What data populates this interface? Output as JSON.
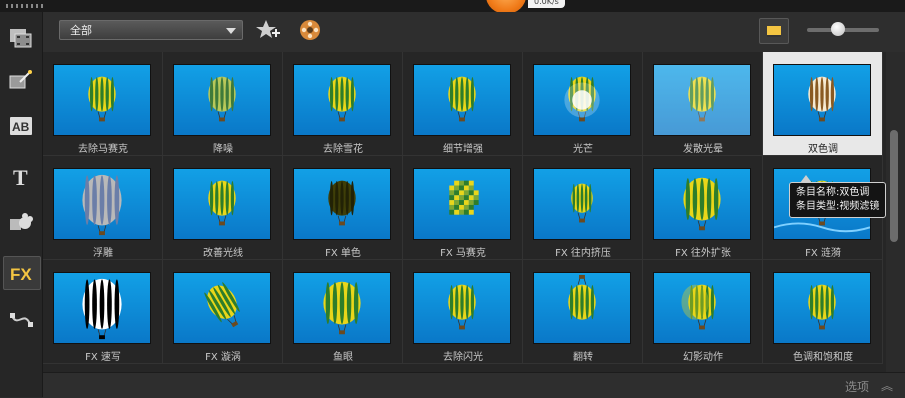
{
  "status": {
    "download_speed": "0.0K/s"
  },
  "toolbar": {
    "filter_value": "全部",
    "add_icon": "star-plus-icon",
    "reel_icon": "film-reel-icon",
    "view_icon": "thumbnail-view-icon",
    "zoom_level": 0.4
  },
  "sidebar": {
    "items": [
      {
        "name": "media",
        "icon": "media-library-icon"
      },
      {
        "name": "instant-project",
        "icon": "magic-wand-icon"
      },
      {
        "name": "transition",
        "icon": "transition-ab-icon"
      },
      {
        "name": "title",
        "icon": "title-t-icon"
      },
      {
        "name": "graphics",
        "icon": "graphics-icon"
      },
      {
        "name": "filter",
        "icon": "fx-icon",
        "label": "FX",
        "active": true
      },
      {
        "name": "path",
        "icon": "motion-path-icon"
      }
    ]
  },
  "effects": [
    {
      "label": "去除马赛克",
      "style": "normal"
    },
    {
      "label": "降噪",
      "style": "soft"
    },
    {
      "label": "去除雪花",
      "style": "normal"
    },
    {
      "label": "细节增强",
      "style": "sharp"
    },
    {
      "label": "光芒",
      "style": "glow"
    },
    {
      "label": "发散光晕",
      "style": "diffuse"
    },
    {
      "label": "双色调",
      "style": "duotone",
      "selected": true
    },
    {
      "label": "浮雕",
      "style": "emboss"
    },
    {
      "label": "改善光线",
      "style": "normal"
    },
    {
      "label": "FX 单色",
      "style": "mono"
    },
    {
      "label": "FX 马赛克",
      "style": "mosaic"
    },
    {
      "label": "FX 往内挤压",
      "style": "pinch"
    },
    {
      "label": "FX 往外扩张",
      "style": "bulge"
    },
    {
      "label": "FX 涟漪",
      "style": "ripple"
    },
    {
      "label": "FX 速写",
      "style": "sketch"
    },
    {
      "label": "FX 漩涡",
      "style": "swirl"
    },
    {
      "label": "鱼眼",
      "style": "fisheye"
    },
    {
      "label": "去除闪光",
      "style": "normal"
    },
    {
      "label": "翻转",
      "style": "flip"
    },
    {
      "label": "幻影动作",
      "style": "ghost"
    },
    {
      "label": "色调和饱和度",
      "style": "normal"
    }
  ],
  "tooltip": {
    "line1": "条目名称:双色调",
    "line2": "条目类型:视频滤镜"
  },
  "footer": {
    "options_label": "选项",
    "options_icon": "chevron-double-up-icon"
  },
  "colors": {
    "sky_blue": "#1aa6e8",
    "balloon_yellow": "#e8d21c",
    "balloon_green": "#2f7a2a",
    "accent_orange": "#f07a18"
  }
}
